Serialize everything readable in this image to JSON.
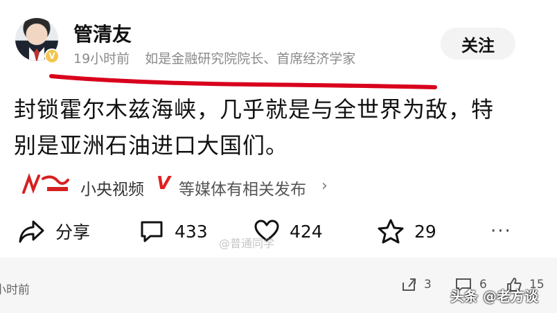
{
  "header": {
    "author_name": "管清友",
    "time": "19小时前",
    "bio": "如是金融研究院院长、首席经济学家",
    "verified_badge": "V",
    "follow_label": "关注"
  },
  "post": {
    "text_line1": "封锁霍尔木兹海峡，几乎就是与全世界为敌，特",
    "text_line2": "别是亚洲石油进口大国们。"
  },
  "source": {
    "name": "小央视频",
    "badge": "V",
    "rest": "等媒体有相关发布",
    "chevron": "›"
  },
  "actions": {
    "share_label": "分享",
    "comments": "433",
    "likes": "424",
    "favorites": "29",
    "more": "···"
  },
  "watermark": {
    "weibo": "@普通同学"
  },
  "bottom": {
    "time": "小时前",
    "share_count": "3",
    "comment_count": "6",
    "like_count": "15",
    "toutiao": "头条 @老方谈"
  },
  "colors": {
    "underline": "#d8001c",
    "verified": "#f3c54a",
    "source_v": "#e02020"
  }
}
